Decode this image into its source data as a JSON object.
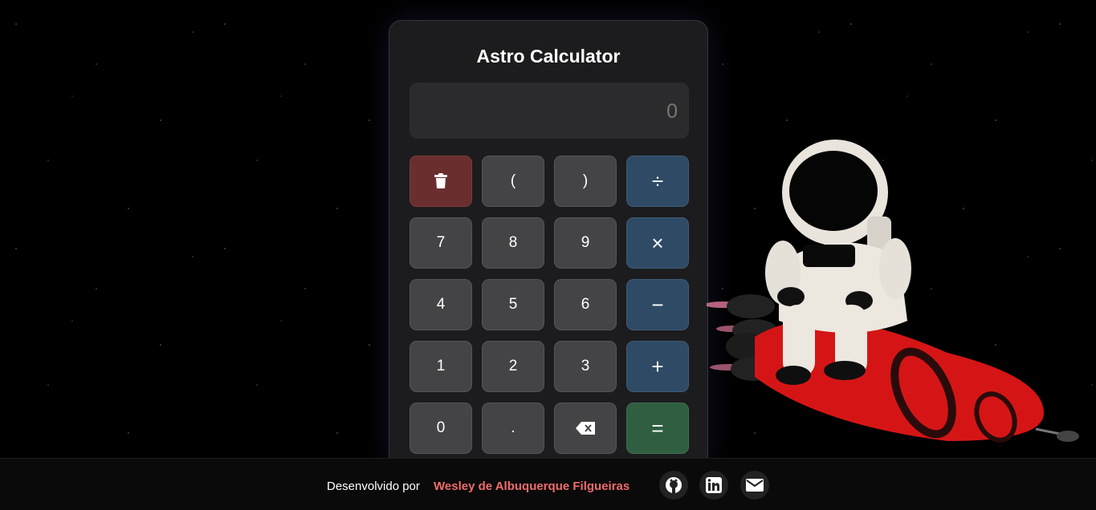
{
  "calculator": {
    "title": "Astro Calculator",
    "display_value": "0"
  },
  "keys": {
    "clear": "clear-icon",
    "paren_open": "(",
    "paren_close": ")",
    "divide": "÷",
    "seven": "7",
    "eight": "8",
    "nine": "9",
    "multiply": "×",
    "four": "4",
    "five": "5",
    "six": "6",
    "minus": "−",
    "one": "1",
    "two": "2",
    "three": "3",
    "plus": "+",
    "zero": "0",
    "dot": ".",
    "backspace": "backspace-icon",
    "equals": "="
  },
  "footer": {
    "developed_by": "Desenvolvido por",
    "author": "Wesley de Albuquerque Filgueiras",
    "links": [
      "github-icon",
      "linkedin-icon",
      "email-icon"
    ]
  },
  "colors": {
    "operator": "#2f4a64",
    "clear": "#6a2e2e",
    "equals": "#2f5e40",
    "number": "#444446",
    "author": "#f06b6b"
  }
}
